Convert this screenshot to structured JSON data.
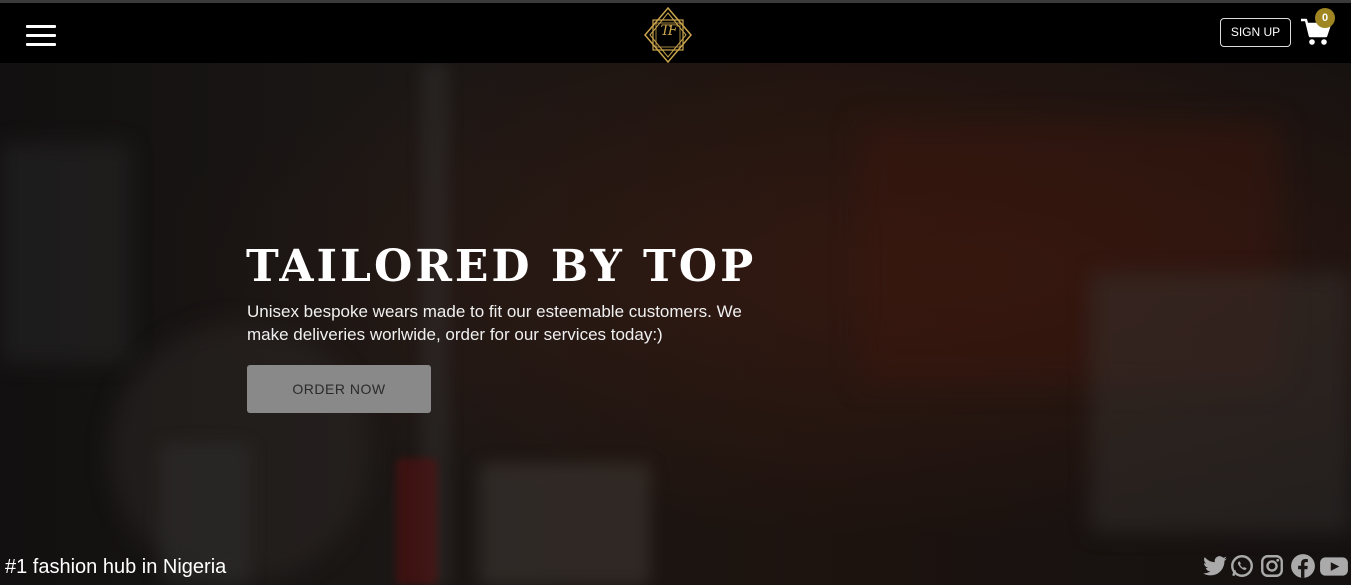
{
  "header": {
    "menu_icon": "hamburger-menu-icon",
    "logo_text": "TF",
    "signup_label": "SIGN UP",
    "cart_icon": "shopping-cart-icon",
    "cart_count": "0",
    "accent_color": "#a08623"
  },
  "hero": {
    "title": "TAILORED BY TOP",
    "subtitle": "Unisex bespoke wears made to fit our esteemable customers. We make deliveries worlwide, order for our services today:)",
    "cta_label": "ORDER NOW"
  },
  "footer": {
    "tagline": "#1 fashion hub in Nigeria",
    "social_icons": [
      "twitter-icon",
      "whatsapp-icon",
      "instagram-icon",
      "facebook-icon",
      "youtube-icon"
    ]
  }
}
